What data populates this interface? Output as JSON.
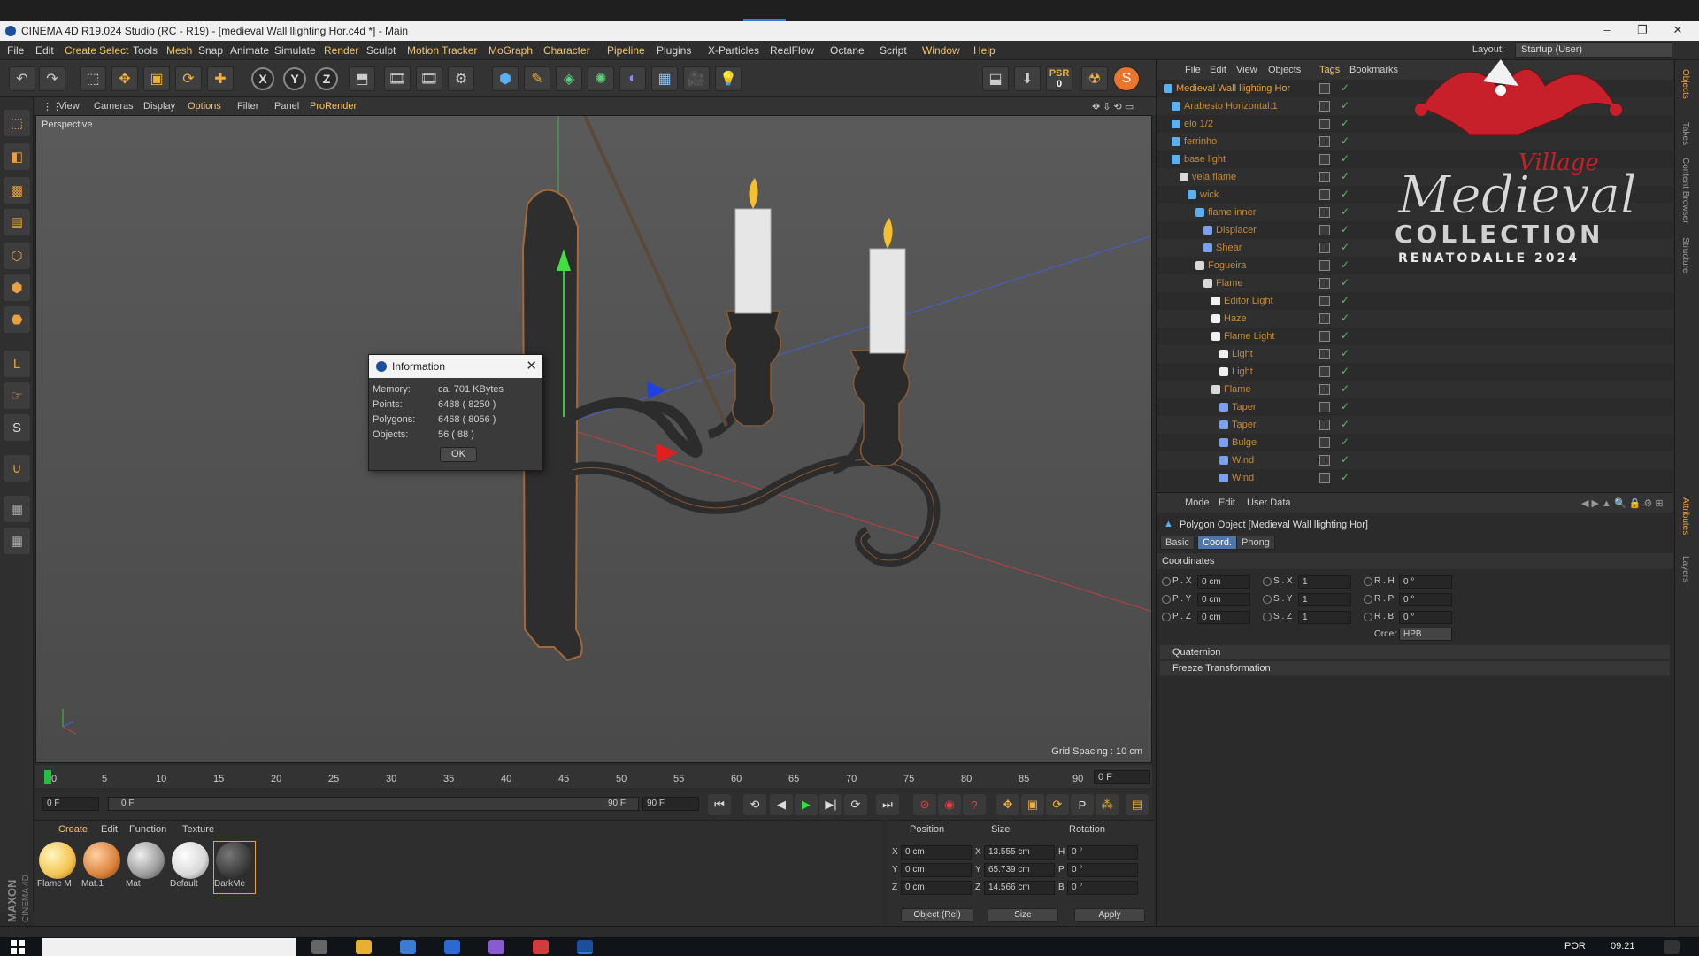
{
  "window": {
    "title": "CINEMA 4D R19.024 Studio (RC - R19) - [medieval Wall llighting Hor.c4d *] - Main",
    "controls": [
      "–",
      "❐",
      "✕"
    ]
  },
  "menubar": {
    "items": [
      "File",
      "Edit",
      "Create",
      "Select",
      "Tools",
      "Mesh",
      "Snap",
      "Animate",
      "Simulate",
      "Render",
      "Sculpt",
      "Motion Tracker",
      "MoGraph",
      "Character",
      "Pipeline",
      "Plugins",
      "X-Particles",
      "RealFlow",
      "Octane",
      "Script",
      "Window",
      "Help"
    ],
    "layout_label": "Layout:",
    "layout_value": "Startup (User)"
  },
  "toolbar": {
    "axis_x": "X",
    "axis_y": "Y",
    "axis_z": "Z",
    "psr_label": "PSR",
    "psr_value": "0"
  },
  "viewport": {
    "menu": [
      "View",
      "Cameras",
      "Display",
      "Options",
      "Filter",
      "Panel",
      "ProRender"
    ],
    "label": "Perspective",
    "grid_spacing": "Grid Spacing : 10 cm"
  },
  "info_dialog": {
    "title": "Information",
    "rows": [
      {
        "label": "Memory:",
        "value": "ca. 701 KBytes"
      },
      {
        "label": "Points:",
        "value": "6488 ( 8250 )"
      },
      {
        "label": "Polygons:",
        "value": "6468 ( 8056 )"
      },
      {
        "label": "Objects:",
        "value": "56 ( 88 )"
      }
    ],
    "ok_label": "OK"
  },
  "timeline": {
    "ticks": [
      "0",
      "5",
      "10",
      "15",
      "20",
      "25",
      "30",
      "35",
      "40",
      "45",
      "50",
      "55",
      "60",
      "65",
      "70",
      "75",
      "80",
      "85",
      "90"
    ],
    "current_frame": "0 F",
    "start_frame": "0 F",
    "range_start": "0 F",
    "range_end": "90 F",
    "end_frame": "90 F"
  },
  "material_manager": {
    "menu": [
      "Create",
      "Edit",
      "Function",
      "Texture"
    ],
    "materials": [
      {
        "name": "Flame M",
        "color": "#f3c350"
      },
      {
        "name": "Mat.1",
        "color": "#d9823c"
      },
      {
        "name": "Mat",
        "color": "#9a9a9a"
      },
      {
        "name": "Default",
        "color": "#d8d8d8"
      },
      {
        "name": "DarkMe",
        "color": "#3a3a3a"
      }
    ]
  },
  "coordinates_manager": {
    "headers": [
      "Position",
      "Size",
      "Rotation"
    ],
    "rows": [
      {
        "axis": "X",
        "pos": "0 cm",
        "size_axis": "X",
        "size": "13.555 cm",
        "rot_axis": "H",
        "rot": "0 °"
      },
      {
        "axis": "Y",
        "pos": "0 cm",
        "size_axis": "Y",
        "size": "65.739 cm",
        "rot_axis": "P",
        "rot": "0 °"
      },
      {
        "axis": "Z",
        "pos": "0 cm",
        "size_axis": "Z",
        "size": "14.566 cm",
        "rot_axis": "B",
        "rot": "0 °"
      }
    ],
    "mode": "Object (Rel)",
    "size_mode": "Size",
    "apply_label": "Apply"
  },
  "object_manager": {
    "menu": [
      "File",
      "Edit",
      "View",
      "Objects",
      "Tags",
      "Bookmarks"
    ],
    "objects": [
      {
        "name": "Medieval Wall llighting Hor",
        "depth": 0,
        "type": "poly"
      },
      {
        "name": "Arabesto Horizontal.1",
        "depth": 1,
        "type": "poly"
      },
      {
        "name": "elo 1/2",
        "depth": 1,
        "type": "poly"
      },
      {
        "name": "ferrinho",
        "depth": 1,
        "type": "poly"
      },
      {
        "name": "base light",
        "depth": 1,
        "type": "poly"
      },
      {
        "name": "vela flame",
        "depth": 2,
        "type": "null"
      },
      {
        "name": "wick",
        "depth": 3,
        "type": "poly"
      },
      {
        "name": "flame inner",
        "depth": 4,
        "type": "poly"
      },
      {
        "name": "Displacer",
        "depth": 5,
        "type": "deformer"
      },
      {
        "name": "Shear",
        "depth": 5,
        "type": "deformer"
      },
      {
        "name": "Fogueira",
        "depth": 4,
        "type": "null"
      },
      {
        "name": "Flame",
        "depth": 5,
        "type": "null"
      },
      {
        "name": "Editor Light",
        "depth": 6,
        "type": "light"
      },
      {
        "name": "Haze",
        "depth": 6,
        "type": "light"
      },
      {
        "name": "Flame Light",
        "depth": 6,
        "type": "light"
      },
      {
        "name": "Light",
        "depth": 7,
        "type": "light"
      },
      {
        "name": "Light",
        "depth": 7,
        "type": "light"
      },
      {
        "name": "Flame",
        "depth": 6,
        "type": "null"
      },
      {
        "name": "Taper",
        "depth": 7,
        "type": "deformer"
      },
      {
        "name": "Taper",
        "depth": 7,
        "type": "deformer"
      },
      {
        "name": "Bulge",
        "depth": 7,
        "type": "deformer"
      },
      {
        "name": "Wind",
        "depth": 7,
        "type": "deformer"
      },
      {
        "name": "Wind",
        "depth": 7,
        "type": "deformer"
      }
    ]
  },
  "watermark": {
    "line1": "Village",
    "line2": "Medieval",
    "line3": "COLLECTION",
    "line4": "RENATODALLE 2024"
  },
  "attribute_manager": {
    "menu": [
      "Mode",
      "Edit",
      "User Data"
    ],
    "title": "Polygon Object [Medieval Wall llighting Hor]",
    "tabs": [
      "Basic",
      "Coord.",
      "Phong"
    ],
    "active_tab": "Coord.",
    "section": "Coordinates",
    "rows": [
      {
        "p_label": "P . X",
        "p_val": "0 cm",
        "s_label": "S . X",
        "s_val": "1",
        "r_label": "R . H",
        "r_val": "0 °"
      },
      {
        "p_label": "P . Y",
        "p_val": "0 cm",
        "s_label": "S . Y",
        "s_val": "1",
        "r_label": "R . P",
        "r_val": "0 °"
      },
      {
        "p_label": "P . Z",
        "p_val": "0 cm",
        "s_label": "S . Z",
        "s_val": "1",
        "r_label": "R . B",
        "r_val": "0 °"
      }
    ],
    "order_label": "Order",
    "order_value": "HPB",
    "folds": [
      "Quaternion",
      "Freeze Transformation"
    ]
  },
  "right_strip": [
    "Objects",
    "Takes",
    "Content Browser",
    "Structure",
    "Attributes",
    "Layers"
  ],
  "taskbar": {
    "lang": "POR",
    "time": "09:21"
  },
  "colors": {
    "accent_orange": "#e8a040",
    "highlight_yellow": "#f3c46a",
    "active_tab_blue": "#4f76a8",
    "viewport_bg": "#555555"
  }
}
